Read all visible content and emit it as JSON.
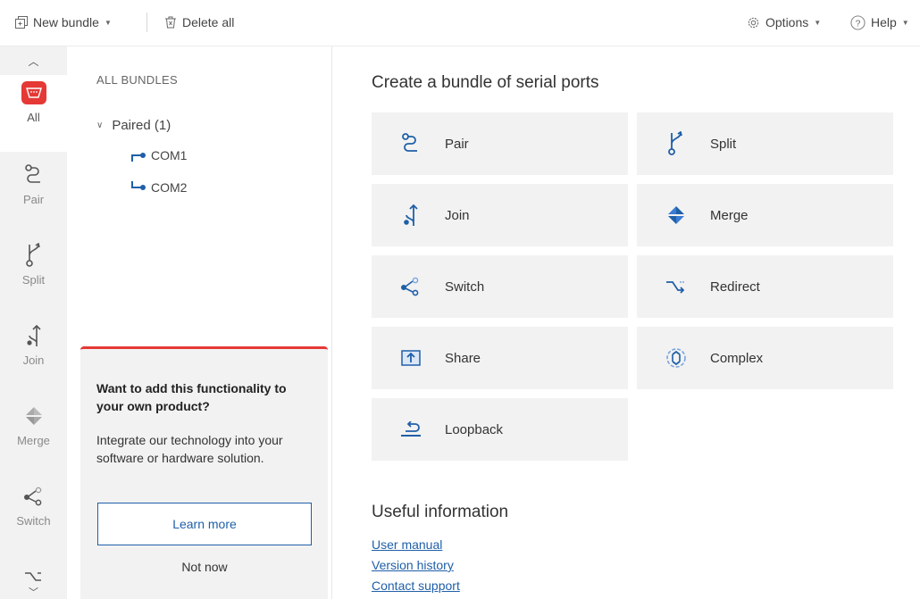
{
  "toolbar": {
    "new_bundle": "New bundle",
    "delete_all": "Delete all",
    "options": "Options",
    "help": "Help"
  },
  "rail": {
    "items": [
      {
        "label": "All",
        "icon": "serial-port-icon",
        "active": true
      },
      {
        "label": "Pair",
        "icon": "pair-icon"
      },
      {
        "label": "Split",
        "icon": "split-icon"
      },
      {
        "label": "Join",
        "icon": "join-icon"
      },
      {
        "label": "Merge",
        "icon": "merge-icon"
      },
      {
        "label": "Switch",
        "icon": "switch-icon"
      }
    ]
  },
  "bundles": {
    "title": "ALL BUNDLES",
    "group": "Paired (1)",
    "ports": [
      "COM1",
      "COM2"
    ]
  },
  "promo": {
    "heading": "Want to add this functionality to your own product?",
    "body": "Integrate our technology into your software or hardware solution.",
    "learn_more": "Learn more",
    "not_now": "Not now"
  },
  "main": {
    "title": "Create a bundle of serial ports",
    "tiles": [
      {
        "label": "Pair",
        "icon": "pair-icon"
      },
      {
        "label": "Split",
        "icon": "split-icon"
      },
      {
        "label": "Join",
        "icon": "join-icon"
      },
      {
        "label": "Merge",
        "icon": "merge-icon"
      },
      {
        "label": "Switch",
        "icon": "switch-icon"
      },
      {
        "label": "Redirect",
        "icon": "redirect-icon"
      },
      {
        "label": "Share",
        "icon": "share-icon"
      },
      {
        "label": "Complex",
        "icon": "complex-icon"
      },
      {
        "label": "Loopback",
        "icon": "loopback-icon"
      }
    ],
    "useful_title": "Useful information",
    "links": [
      "User manual",
      "Version history",
      "Contact support"
    ]
  },
  "colors": {
    "accent": "#1f5fa8",
    "brand_red": "#e53935",
    "tile_bg": "#f2f2f2"
  }
}
